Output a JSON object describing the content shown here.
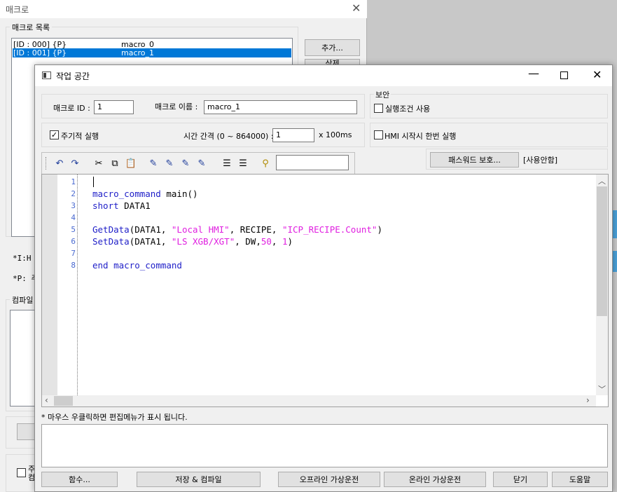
{
  "bg_window": {
    "title": "매크로",
    "list_group": "매크로 목록",
    "macros": [
      {
        "id": "[ID : 000] {P}",
        "name": "macro_0"
      },
      {
        "id": "[ID : 001] {P}",
        "name": "macro_1"
      }
    ],
    "add_button": "추가...",
    "partial_button": "삭제",
    "note_i": "*I:H",
    "note_p": "*P: 주",
    "compile_group": "컴파일",
    "bottom_cb_line1": "주",
    "bottom_cb_line2": "컴"
  },
  "dialog": {
    "title": "작업 공간",
    "macro_id_label": "매크로 ID :",
    "macro_id_value": "1",
    "macro_name_label": "매크로 이름 :",
    "macro_name_value": "macro_1",
    "security_group": "보안",
    "use_condition": "실행조건 사용",
    "periodic_label": "주기적 실행",
    "periodic_checked": true,
    "interval_label": "시간 간격 (0 ~ 864000) :",
    "interval_value": "1",
    "interval_unit": "x 100ms",
    "hmi_once": "HMI 시작시 한번 실행",
    "password_button": "패스워드 보호...",
    "password_status": "[사용안함]",
    "toolbar_search": "",
    "hint": "* 마우스 우클릭하면 편집메뉴가 표시 됩니다.",
    "buttons": {
      "functions": "함수...",
      "save_compile": "저장 & 컴파일",
      "offline_sim": "오프라인 가상운전",
      "online_sim": "온라인 가상운전",
      "close": "닫기",
      "help": "도움말"
    }
  },
  "code": {
    "line_numbers": [
      "1",
      "2",
      "3",
      "4",
      "5",
      "6",
      "7",
      "8"
    ],
    "l2_kw": "macro_command",
    "l2_rest": " main()",
    "l3_kw": "short",
    "l3_rest": " DATA1",
    "l5_fn": "GetData",
    "l5_a": "(DATA1, ",
    "l5_s1": "\"Local HMI\"",
    "l5_b": ", RECIPE, ",
    "l5_s2": "\"ICP_RECIPE.Count\"",
    "l5_c": ")",
    "l6_fn": "SetData",
    "l6_a": "(DATA1, ",
    "l6_s1": "\"LS XGB/XGT\"",
    "l6_b": ", DW,",
    "l6_n1": "50",
    "l6_c": ", ",
    "l6_n2": "1",
    "l6_d": ")",
    "l8_kw1": "end",
    "l8_sp": " ",
    "l8_kw2": "macro_command"
  },
  "colors": {
    "keyword": "#1e1ec8",
    "string": "#e020e0",
    "selection": "#0078d7"
  }
}
